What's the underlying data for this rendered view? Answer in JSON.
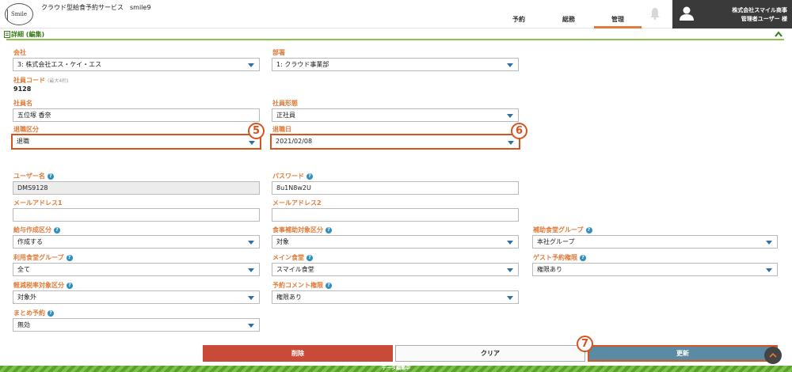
{
  "header": {
    "logo_text": "Smile",
    "app_title": "クラウド型給食予約サービス　smile9",
    "nav": [
      {
        "label": "予約",
        "active": false
      },
      {
        "label": "総務",
        "active": false
      },
      {
        "label": "管理",
        "active": true
      }
    ],
    "user_company": "株式会社スマイル商事",
    "user_name": "管理者ユーザー 様"
  },
  "section": {
    "title": "詳細 (編集)"
  },
  "form": {
    "company": {
      "label": "会社",
      "value": "3: 株式会社エス・ケイ・エス"
    },
    "department": {
      "label": "部署",
      "value": "1: クラウド事業部"
    },
    "employee_code": {
      "label": "社員コード",
      "hint": "(最大4桁)",
      "value": "9128"
    },
    "employee_name": {
      "label": "社員名",
      "value": "五位塚 香奈"
    },
    "employment_type": {
      "label": "社員形態",
      "value": "正社員"
    },
    "retirement_type": {
      "label": "退職区分",
      "value": "退職"
    },
    "retirement_date": {
      "label": "退職日",
      "value": "2021/02/08"
    },
    "username": {
      "label": "ユーザー名",
      "value": "DMS9128"
    },
    "password": {
      "label": "パスワード",
      "value": "8u1N8w2U"
    },
    "email1": {
      "label": "メールアドレス1",
      "value": ""
    },
    "email2": {
      "label": "メールアドレス2",
      "value": ""
    },
    "salary_type": {
      "label": "給与作成区分",
      "value": "作成する"
    },
    "meal_subsidy": {
      "label": "食事補助対象区分",
      "value": "対象"
    },
    "aux_cafeteria_group": {
      "label": "補助食堂グループ",
      "value": "本社グループ"
    },
    "cafeteria_group": {
      "label": "利用食堂グループ",
      "value": "全て"
    },
    "main_cafeteria": {
      "label": "メイン食堂",
      "value": "スマイル食堂"
    },
    "guest_permission": {
      "label": "ゲスト予約権限",
      "value": "権限あり"
    },
    "reduced_tax": {
      "label": "軽減税率対象区分",
      "value": "対象外"
    },
    "comment_permission": {
      "label": "予約コメント権限",
      "value": "権限あり"
    },
    "bulk_reservation": {
      "label": "まとめ予約",
      "value": "無効"
    }
  },
  "help_glyph": "?",
  "badges": {
    "b5": "5",
    "b6": "6",
    "b7": "7"
  },
  "buttons": {
    "delete": "削除",
    "clear": "クリア",
    "update": "更新"
  },
  "footer": {
    "status": "データ編集中"
  },
  "colors": {
    "accent": "#e07b39",
    "highlight": "#d9531e",
    "green": "#8bc34a",
    "delete": "#c84b3a",
    "update": "#5b8aa4"
  }
}
